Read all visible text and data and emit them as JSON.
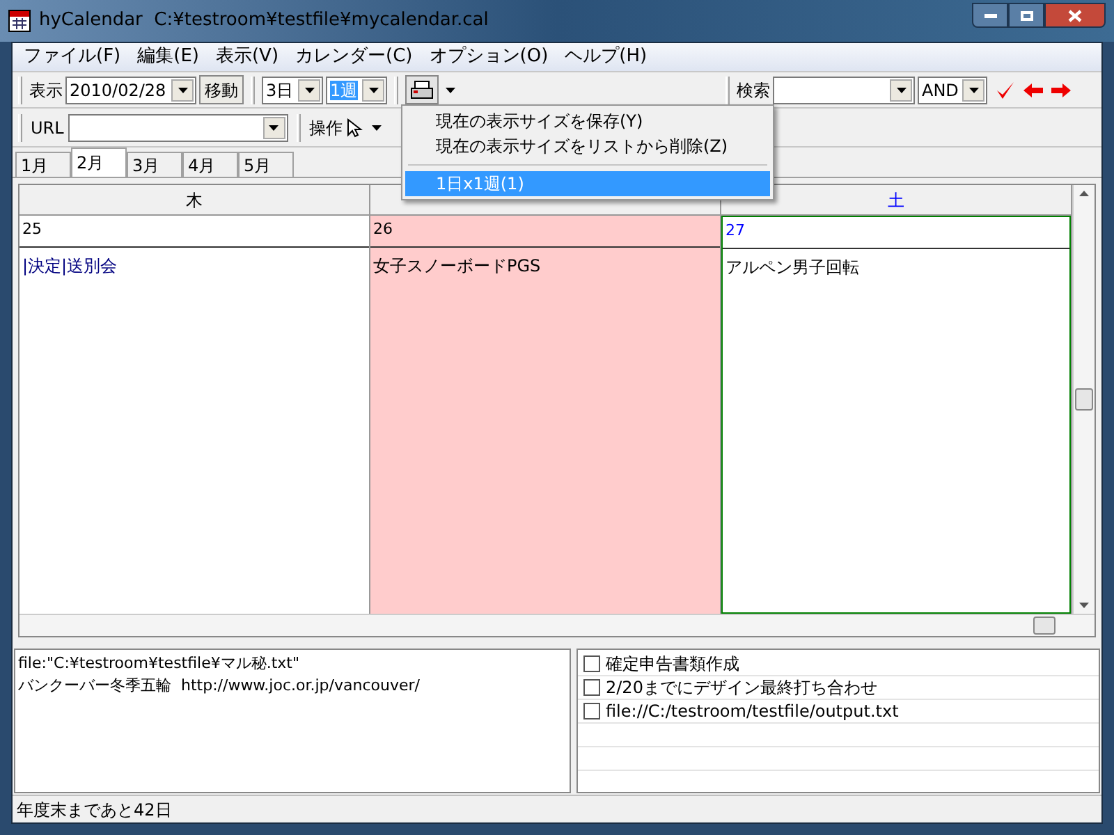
{
  "window": {
    "title": "hyCalendar  C:¥testroom¥testfile¥mycalendar.cal"
  },
  "menu": [
    "ファイル(F)",
    "編集(E)",
    "表示(V)",
    "カレンダー(C)",
    "オプション(O)",
    "ヘルプ(H)"
  ],
  "toolbar": {
    "view_label": "表示",
    "date": "2010/02/28",
    "go_button": "移動",
    "days": "3日",
    "weeks": "1週",
    "search_label": "検索",
    "mode": "AND"
  },
  "toolbar2": {
    "url_label": "URL",
    "operation_label": "操作"
  },
  "month_tabs": [
    {
      "label": "1月",
      "selected": false
    },
    {
      "label": "2月",
      "selected": true
    },
    {
      "label": "3月",
      "selected": false
    },
    {
      "label": "4月",
      "selected": false
    },
    {
      "label": "5月",
      "selected": false
    }
  ],
  "calendar": {
    "days": [
      {
        "weekday": "木",
        "date": "25",
        "event": "|決定|送別会",
        "kind": "weekday",
        "highlighted": false,
        "today": false
      },
      {
        "date": "26",
        "event": "女子スノーボードPGS",
        "kind": "weekday",
        "highlighted": true,
        "today": false
      },
      {
        "weekday": "土",
        "date": "27",
        "event": "アルペン男子回転",
        "kind": "saturday",
        "highlighted": false,
        "today": true
      }
    ]
  },
  "popup_menu": [
    {
      "kind": "item",
      "label": "現在の表示サイズを保存(Y)",
      "selected": false
    },
    {
      "kind": "item",
      "label": "現在の表示サイズをリストから削除(Z)",
      "selected": false
    },
    {
      "kind": "separator"
    },
    {
      "kind": "item",
      "label": "1日x1週(1)",
      "selected": true
    }
  ],
  "memo": [
    "file:\"C:¥testroom¥testfile¥マル秘.txt\"",
    "バンクーバー冬季五輪  http://www.joc.or.jp/vancouver/"
  ],
  "todos": [
    {
      "label": "確定申告書類作成",
      "checked": false
    },
    {
      "label": "2/20までにデザイン最終打ち合わせ",
      "checked": false
    },
    {
      "label": "file://C:/testroom/testfile/output.txt",
      "checked": false
    }
  ],
  "status_bar": "年度末まであと42日"
}
